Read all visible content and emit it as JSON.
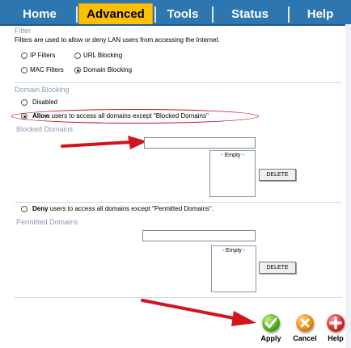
{
  "tabs": [
    {
      "label": "Home",
      "active": false
    },
    {
      "label": "Advanced",
      "active": true
    },
    {
      "label": "Tools",
      "active": false
    },
    {
      "label": "Status",
      "active": false
    },
    {
      "label": "Help",
      "active": false
    }
  ],
  "filter": {
    "title": "Filter",
    "description": "Filters are used to allow or deny LAN users from accessing the Internet.",
    "options": [
      {
        "label": "IP Filters",
        "selected": false
      },
      {
        "label": "URL Blocking",
        "selected": false
      },
      {
        "label": "MAC Filters",
        "selected": false
      },
      {
        "label": "Domain Blocking",
        "selected": true
      }
    ]
  },
  "domain_blocking": {
    "title": "Domain Blocking",
    "disabled_label": "Disabled",
    "allow_bold": "Allow",
    "allow_rest": " users to access all domains except \"Blocked Domains\"",
    "deny_bold": "Deny",
    "deny_rest": " users to access all domains except \"Permitted Domains\"."
  },
  "blocked_domains": {
    "title": "Blocked Domains",
    "list_placeholder": "- Empty -",
    "delete_label": "DELETE"
  },
  "permitted_domains": {
    "title": "Permitted Domains",
    "list_placeholder": "- Empty -",
    "delete_label": "DELETE"
  },
  "actions": {
    "apply": "Apply",
    "cancel": "Cancel",
    "help": "Help"
  },
  "colors": {
    "tabbar": "#2d76b0",
    "active_tab": "#ffc000",
    "section_title": "#8a9bb1",
    "annotation_red": "#c0141b"
  }
}
